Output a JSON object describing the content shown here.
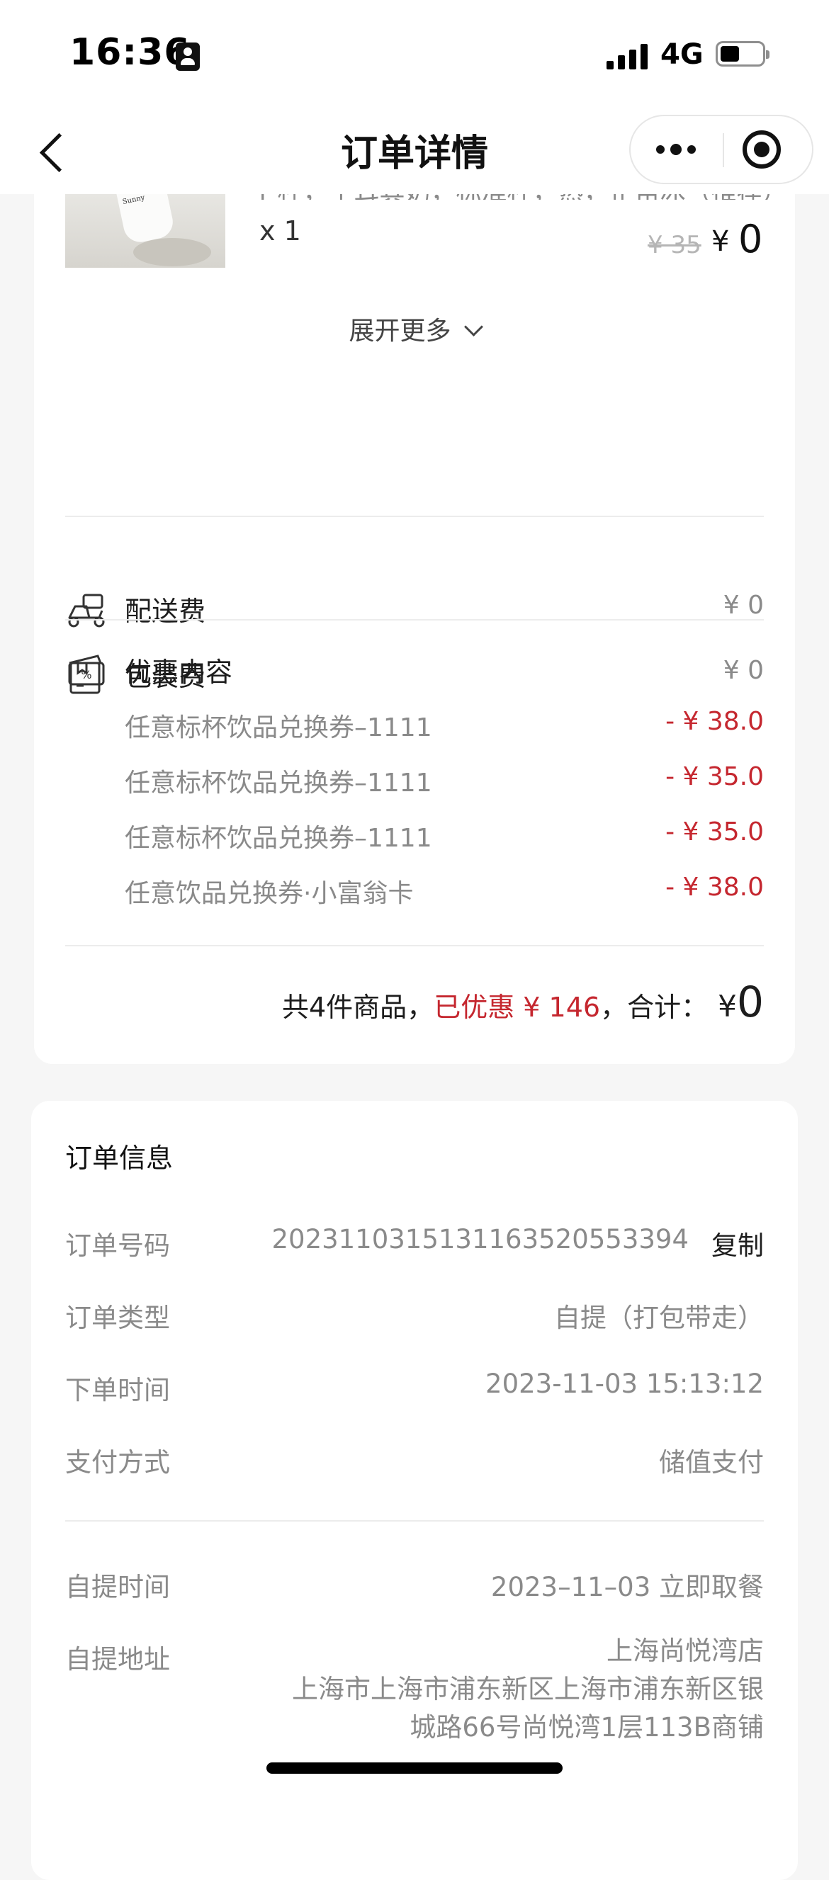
{
  "status_bar": {
    "time": "16:36",
    "network": "4G"
  },
  "nav": {
    "title": "订单详情"
  },
  "product": {
    "spec": "[ 杯，土耳其奶，标准杯，热，正常冰（推荐）]",
    "quantity": "x 1",
    "original_price": "¥ 35",
    "price_symbol": "¥",
    "price": "0",
    "expand_label": "展开更多"
  },
  "fees": [
    {
      "label": "配送费",
      "value": "¥ 0",
      "icon": "scooter-icon"
    },
    {
      "label": "包装费",
      "value": "¥ 0",
      "icon": "package-icon"
    }
  ],
  "discounts": {
    "label": "优惠内容",
    "icon": "coupon-icon",
    "items": [
      {
        "name": "任意标杯饮品兑换券–1111",
        "value": "- ¥ 38.0"
      },
      {
        "name": "任意标杯饮品兑换券–1111",
        "value": "- ¥ 35.0"
      },
      {
        "name": "任意标杯饮品兑换券–1111",
        "value": "- ¥ 35.0"
      },
      {
        "name": "任意饮品兑换券·小富翁卡",
        "value": "- ¥ 38.0"
      }
    ]
  },
  "summary": {
    "count_text": "共4件商品，",
    "discount_text": "已优惠 ¥ 146",
    "total_label": "，合计：",
    "currency": "¥",
    "total": "0"
  },
  "order_info": {
    "title": "订单信息",
    "order_no_label": "订单号码",
    "order_no": "2023110315131163520553394",
    "copy_label": "复制",
    "type_label": "订单类型",
    "type": "自提（打包带走）",
    "time_label": "下单时间",
    "time": "2023-11-03 15:13:12",
    "pay_label": "支付方式",
    "pay": "储值支付",
    "pickup_time_label": "自提时间",
    "pickup_time": "2023–11–03 立即取餐",
    "pickup_addr_label": "自提地址",
    "store_name": "上海尚悦湾店",
    "address_line1": "上海市上海市浦东新区上海市浦东新区银",
    "address_line2": "城路66号尚悦湾1层113B商铺"
  },
  "colors": {
    "accent_red": "#c5272f",
    "muted_text": "#8a8a8a",
    "background": "#f6f6f6"
  }
}
